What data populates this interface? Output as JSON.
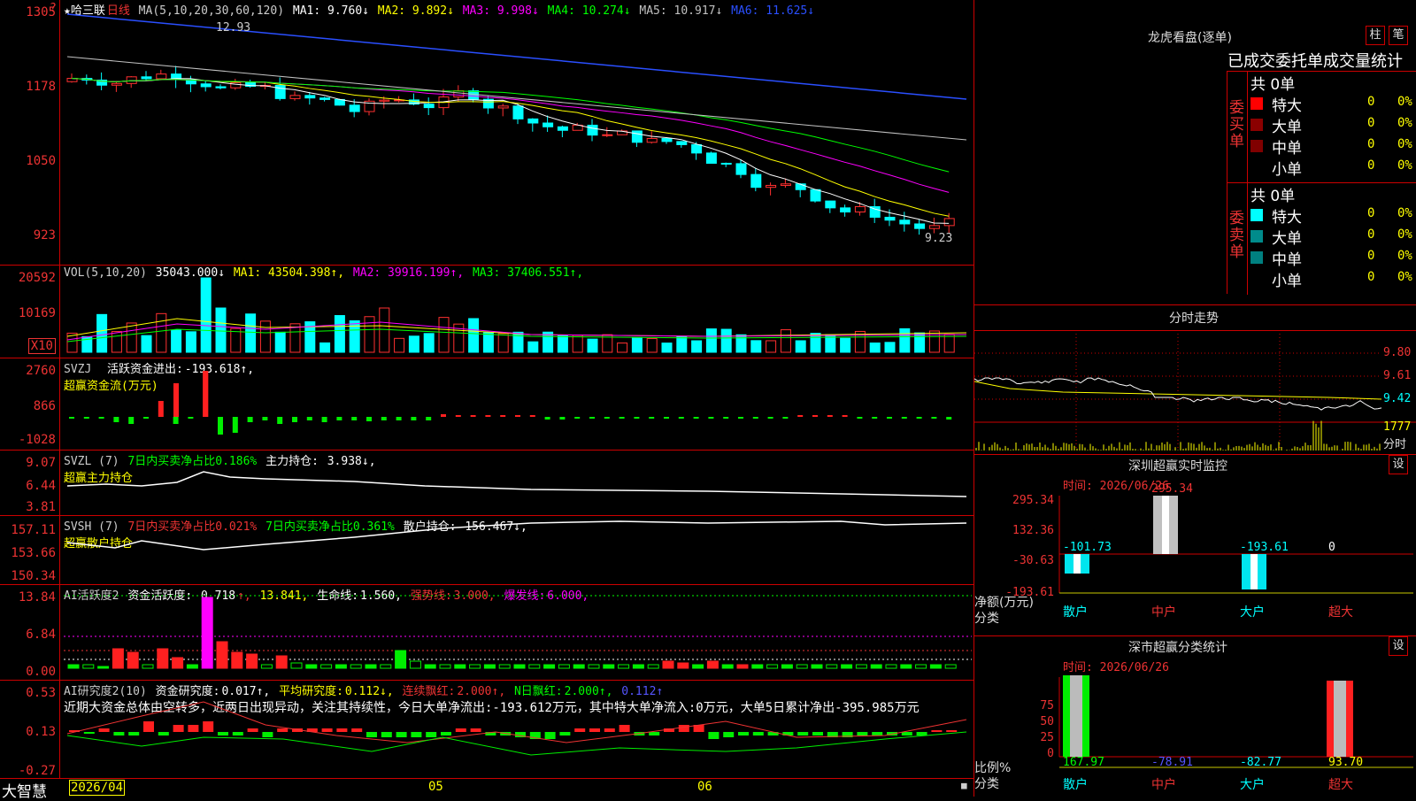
{
  "app": {
    "name": "大智慧",
    "date_label": "2026/04",
    "months": [
      "05",
      "06"
    ]
  },
  "kline": {
    "stock": "★哈三联",
    "period": "日线",
    "ma_label": "MA(5,10,20,30,60,120)",
    "ma": [
      {
        "label": "MA1:",
        "value": "9.760↓",
        "color": "#ffffff"
      },
      {
        "label": "MA2:",
        "value": "9.892↓",
        "color": "#ffff00"
      },
      {
        "label": "MA3:",
        "value": "9.998↓",
        "color": "#ff00ff"
      },
      {
        "label": "MA4:",
        "value": "10.274↓",
        "color": "#00ff00"
      },
      {
        "label": "MA5:",
        "value": "10.917↓",
        "color": "#c0c0c0"
      },
      {
        "label": "MA6:",
        "value": "11.625↓",
        "color": "#2a4fff"
      }
    ],
    "axis": [
      "1305",
      "1178",
      "1050",
      "923"
    ],
    "high_label": "12.93",
    "low_label": "9.23"
  },
  "vol": {
    "title": "VOL(5,10,20)",
    "value": "35043.000↓",
    "ma": [
      {
        "label": "MA1:",
        "value": "43504.398↑",
        "color": "#ffff00"
      },
      {
        "label": "MA2:",
        "value": "39916.199↑",
        "color": "#ff00ff"
      },
      {
        "label": "MA3:",
        "value": "37406.551↑",
        "color": "#00ff00"
      }
    ],
    "axis": [
      "20592",
      "10169"
    ],
    "unit": "X10"
  },
  "svzj": {
    "title": "SVZJ",
    "text": "活跃资金进出:",
    "value": "-193.618↑,",
    "subtitle": "超赢资金流(万元)",
    "axis": [
      "2760",
      "866",
      "-1028"
    ]
  },
  "svzl": {
    "title": "SVZL (7)",
    "text": "7日内买卖净占比0.186%",
    "text2": "主力持仓:",
    "value": "3.938↓,",
    "subtitle": "超赢主力持仓",
    "axis": [
      "9.07",
      "6.44",
      "3.81"
    ]
  },
  "svsh": {
    "title": "SVSH (7)",
    "text": "7日内买卖净占比0.021%",
    "text2": "7日内买卖净占比0.361%",
    "text3": "散户持仓:",
    "value": "156.467↓,",
    "subtitle": "超赢散户持仓",
    "axis": [
      "157.11",
      "153.66",
      "150.34"
    ]
  },
  "ai1": {
    "title": "AI活跃度2",
    "text": "资金活跃度:",
    "value": "0.718",
    "v2": "13.841,",
    "text3": "生命线:",
    "value3": "1.560,",
    "text4": "强势线:",
    "value4": "3.000,",
    "text5": "爆发线:",
    "value5": "6.000,",
    "axis": [
      "13.84",
      "6.84",
      "0.00"
    ]
  },
  "ai2": {
    "title": "AI研究度2(10)",
    "text": "资金研究度:",
    "value": "0.017↑,",
    "text2": "平均研究度:",
    "value2": "0.112↓,",
    "text3": "连续飘红:",
    "value3": "2.000↑,",
    "text4": "N日飘红:",
    "value4": "2.000↑,",
    "value5": "0.112↑",
    "note": "近期大资金总体由空转多，近两日出现异动，关注其持续性，今日大单净流出:-193.612万元，其中特大单净流入:0万元，大单5日累计净出-395.985万元",
    "axis": [
      "0.53",
      "0.13",
      "-0.27"
    ]
  },
  "lhb": {
    "title": "龙虎看盘(逐单)",
    "btn1": "柱",
    "btn2": "笔",
    "subtitle": "已成交委托单成交量统计",
    "buy": {
      "side": "委买单",
      "total": "共 0单",
      "rows": [
        {
          "name": "特大",
          "n": "0",
          "p": "0%"
        },
        {
          "name": "大单",
          "n": "0",
          "p": "0%"
        },
        {
          "name": "中单",
          "n": "0",
          "p": "0%"
        },
        {
          "name": "小单",
          "n": "0",
          "p": "0%"
        }
      ]
    },
    "sell": {
      "side": "委卖单",
      "total": "共 0单",
      "rows": [
        {
          "name": "特大",
          "n": "0",
          "p": "0%"
        },
        {
          "name": "大单",
          "n": "0",
          "p": "0%"
        },
        {
          "name": "中单",
          "n": "0",
          "p": "0%"
        },
        {
          "name": "小单",
          "n": "0",
          "p": "0%"
        }
      ]
    }
  },
  "intraday": {
    "title": "分时走势",
    "axis": [
      "9.80",
      "9.61",
      "9.42"
    ],
    "vol": "1777",
    "vol_label": "分时"
  },
  "monitor": {
    "title": "深圳超赢实时监控",
    "btn": "设",
    "time": "时间: 2026/06/26",
    "axis": [
      "295.34",
      "132.36",
      "-30.63",
      "-193.61"
    ],
    "ylabel": "净额(万元)",
    "xlabel": "分类",
    "cats": [
      "散户",
      "中户",
      "大户",
      "超大"
    ],
    "values": [
      "-101.73",
      "295.34",
      "-193.61",
      "0"
    ]
  },
  "classify": {
    "title": "深市超赢分类统计",
    "btn": "设",
    "time": "时间: 2026/06/26",
    "axis": [
      "75",
      "50",
      "25",
      "0"
    ],
    "ylabel": "比例%",
    "xlabel": "分类",
    "cats": [
      "散户",
      "中户",
      "大户",
      "超大"
    ],
    "values": [
      "167.97",
      "-78.91",
      "-82.77",
      "93.70"
    ]
  }
}
